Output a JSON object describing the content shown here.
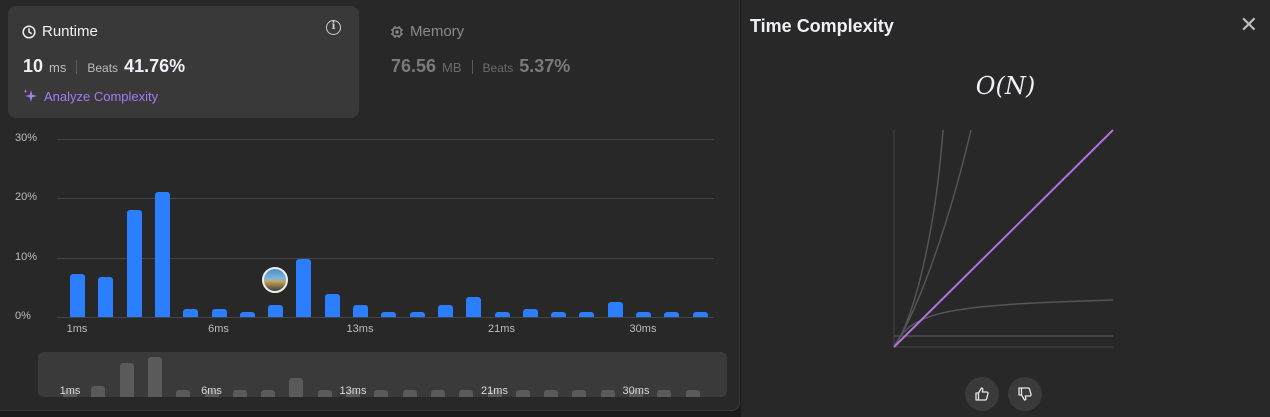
{
  "runtime": {
    "label": "Runtime",
    "value": "10",
    "unit": "ms",
    "beats_label": "Beats",
    "beats_value": "41.76%",
    "analyze_label": "Analyze Complexity"
  },
  "memory": {
    "label": "Memory",
    "value": "76.56",
    "unit": "MB",
    "beats_label": "Beats",
    "beats_value": "5.37%"
  },
  "chart_data": {
    "type": "bar",
    "yticks": [
      "30%",
      "20%",
      "10%",
      "0%"
    ],
    "ylim": [
      0,
      30
    ],
    "xtick_labels": [
      "1ms",
      "6ms",
      "13ms",
      "21ms",
      "30ms"
    ],
    "values": [
      7.3,
      6.8,
      18,
      21,
      1.4,
      1.4,
      0.9,
      2,
      9.8,
      3.9,
      2,
      0.9,
      0.9,
      2,
      3.3,
      0.9,
      1.4,
      0.9,
      0.9,
      2.6,
      0.9,
      0.9,
      0.9
    ],
    "highlight_index": 7,
    "bar_color": "#2b7fff"
  },
  "mini_chart": {
    "values": [
      3,
      6,
      18,
      21,
      1,
      1,
      1,
      1,
      9.8,
      2,
      1,
      1,
      1,
      1,
      2,
      1,
      1,
      1,
      1,
      2,
      1,
      1,
      1
    ],
    "labels": [
      "1ms",
      "6ms",
      "13ms",
      "21ms",
      "30ms"
    ]
  },
  "complexity": {
    "title": "Time Complexity",
    "notation": "O(N)",
    "accent": "#b46ee0"
  },
  "icons": {
    "runtime": "clock-icon",
    "memory": "cpu-icon",
    "analyze": "sparkles-icon",
    "info": "info-icon",
    "close": "close-icon",
    "thumbs_up": "thumbs-up-icon",
    "thumbs_down": "thumbs-down-icon"
  }
}
